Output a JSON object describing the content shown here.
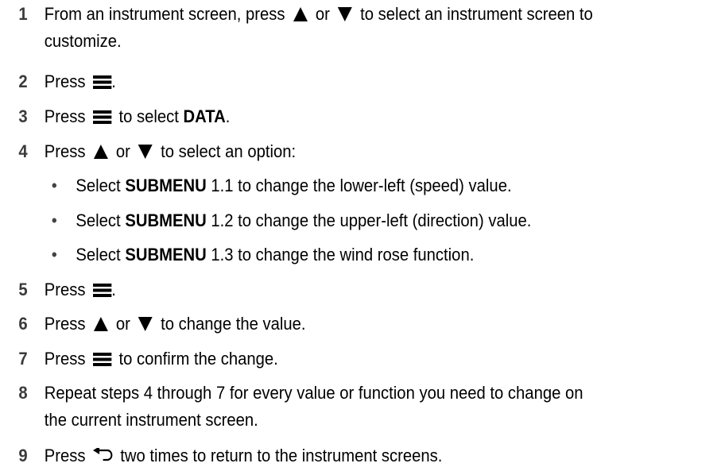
{
  "steps": [
    {
      "num": "1",
      "t1": "From an instrument screen, press",
      "t2": "or",
      "t3": "to select an instrument screen to",
      "t4": "customize."
    },
    {
      "num": "2",
      "t1": "Press",
      "t2": "."
    },
    {
      "num": "3",
      "t1": "Press",
      "t2": "to select",
      "bold": "DATA",
      "t3": "."
    },
    {
      "num": "4",
      "t1": "Press",
      "t2": "or",
      "t3": "to select an option:"
    },
    {
      "num": "5",
      "t1": "Press",
      "t2": "."
    },
    {
      "num": "6",
      "t1": "Press",
      "t2": "or",
      "t3": "to change the value."
    },
    {
      "num": "7",
      "t1": "Press",
      "t2": "to confirm the change."
    },
    {
      "num": "8",
      "t1": "Repeat steps 4 through 7 for every value or function you need to change on",
      "t2": "the current instrument screen."
    },
    {
      "num": "9",
      "t1": "Press",
      "t2": "two times to return to the instrument screens."
    }
  ],
  "options": [
    {
      "pre": "Select",
      "bold": "SUBMENU",
      "post": "1.1 to change the lower-left (speed) value."
    },
    {
      "pre": "Select",
      "bold": "SUBMENU",
      "post": "1.2 to change the upper-left (direction) value."
    },
    {
      "pre": "Select",
      "bold": "SUBMENU",
      "post": "1.3 to change the wind rose function."
    }
  ],
  "bullet": "•",
  "icons": {
    "up": "up-arrow-icon",
    "down": "down-arrow-icon",
    "menu": "menu-icon",
    "back": "back-icon"
  }
}
